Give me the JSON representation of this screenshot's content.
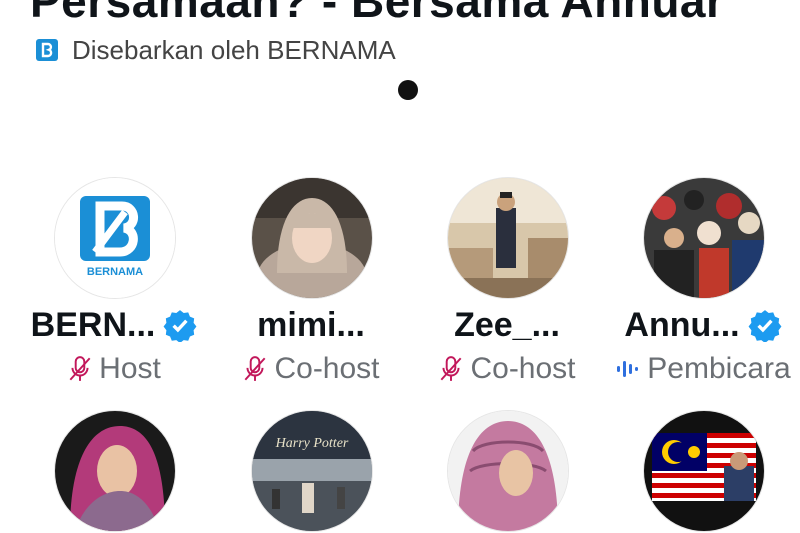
{
  "space": {
    "title": "Persamaan? - Bersama Annuar",
    "shared_by": "Disebarkan oleh BERNAMA",
    "shared_logo_letter": "B"
  },
  "participants": [
    {
      "name": "BERN...",
      "role": "Host",
      "verified": true,
      "avatar": "bernama-logo",
      "avatar_label": "BERNAMA"
    },
    {
      "name": "mimi...",
      "role": "Co-host",
      "verified": false,
      "avatar": "woman-hijab-photo"
    },
    {
      "name": "Zee_...",
      "role": "Co-host",
      "verified": false,
      "avatar": "man-in-room-photo"
    },
    {
      "name": "Annu...",
      "role": "Pembicara",
      "verified": true,
      "avatar": "crowd-photo"
    },
    {
      "name": "",
      "role": "",
      "avatar": "woman-pink-hijab-photo"
    },
    {
      "name": "",
      "role": "",
      "avatar": "harry-potter-studio-photo",
      "avatar_label": "Harry Potter"
    },
    {
      "name": "",
      "role": "",
      "avatar": "woman-pink-scarf-photo"
    },
    {
      "name": "",
      "role": "",
      "avatar": "malaysia-flag-photo"
    }
  ],
  "colors": {
    "verified": "#1d9bf0",
    "muted_mic": "#c2185b",
    "speaking_wave": "#2f6fde",
    "bernama_blue": "#1b8fd6"
  }
}
